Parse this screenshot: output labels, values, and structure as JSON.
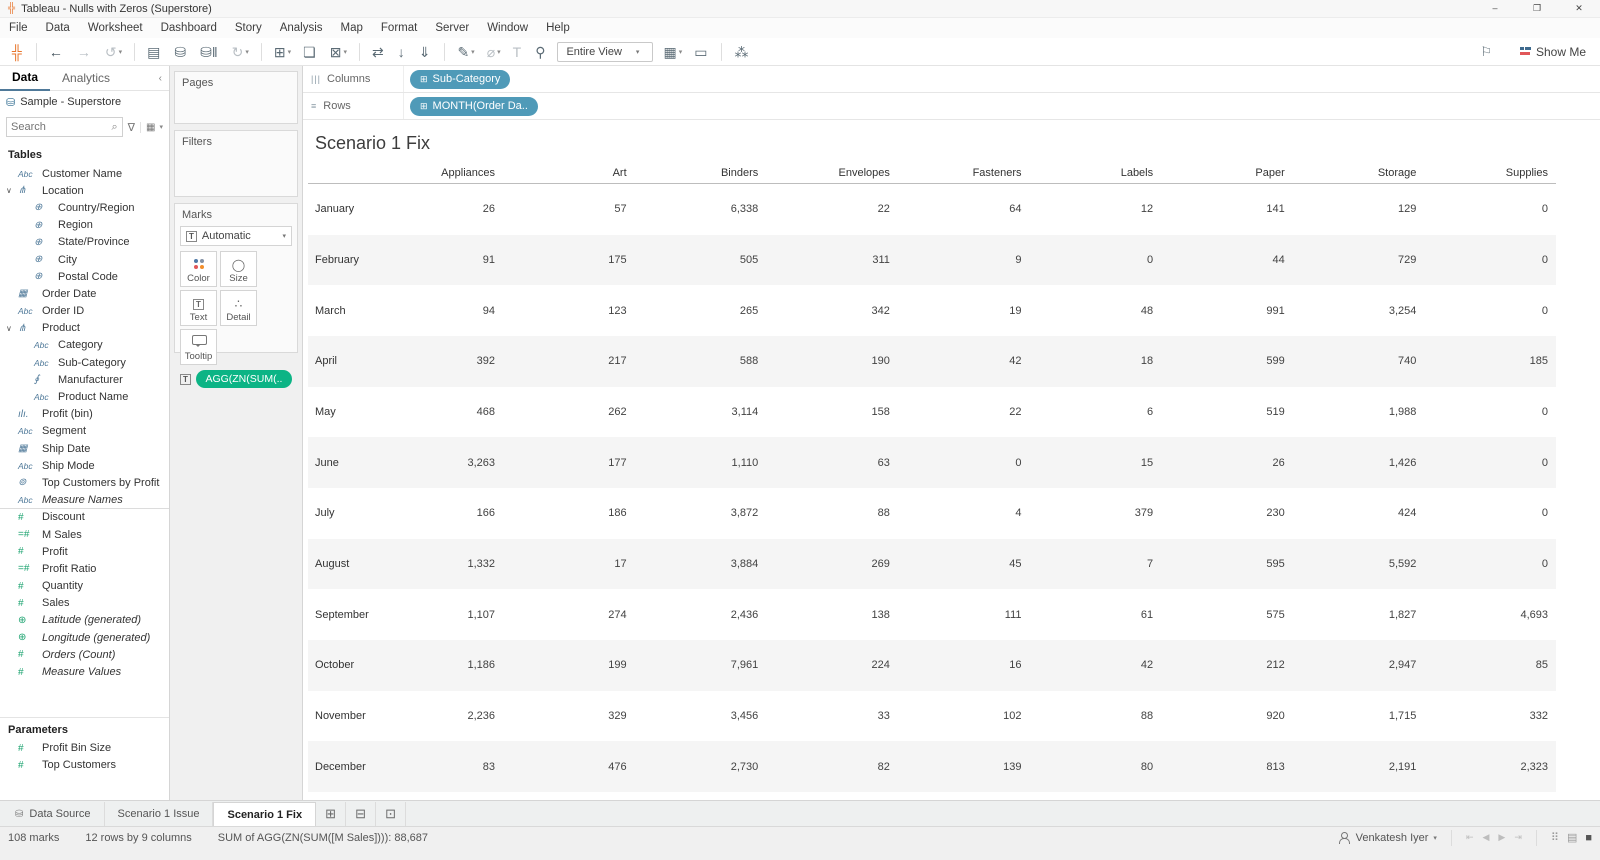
{
  "window": {
    "logo_glyph": "╬",
    "title": "Tableau - Nulls with Zeros (Superstore)",
    "controls": {
      "minimize": "–",
      "restore": "❐",
      "close": "✕"
    }
  },
  "menu": {
    "items": [
      "File",
      "Data",
      "Worksheet",
      "Dashboard",
      "Story",
      "Analysis",
      "Map",
      "Format",
      "Server",
      "Window",
      "Help"
    ]
  },
  "toolbar": {
    "buttons_left": [
      {
        "name": "tableau-logo-btn",
        "glyph": "╬",
        "inter": "true"
      },
      {
        "name": "toolbar-separator",
        "kind": "sep",
        "inter": "false"
      },
      {
        "name": "back-button",
        "glyph": "←",
        "inter": "true"
      },
      {
        "name": "forward-button",
        "glyph": "→",
        "disabled": "true",
        "inter": "true"
      },
      {
        "name": "replay-button",
        "glyph": "↺",
        "caret": "▾",
        "disabled": "true",
        "inter": "true"
      },
      {
        "name": "toolbar-separator",
        "kind": "sep",
        "inter": "false"
      },
      {
        "name": "save-button",
        "glyph": "▤",
        "inter": "true"
      },
      {
        "name": "new-datasource-button",
        "glyph": "⛁",
        "inter": "true"
      },
      {
        "name": "pause-updates-button",
        "glyph": "⛁‖",
        "inter": "true"
      },
      {
        "name": "auto-update-button",
        "glyph": "↻",
        "caret": "▾",
        "disabled": "true",
        "inter": "true"
      },
      {
        "name": "toolbar-separator",
        "kind": "sep",
        "inter": "false"
      },
      {
        "name": "new-worksheet-button",
        "glyph": "⊞",
        "caret": "▾",
        "inter": "true"
      },
      {
        "name": "duplicate-button",
        "glyph": "❏",
        "inter": "true"
      },
      {
        "name": "clear-sheet-button",
        "glyph": "⊠",
        "caret": "▾",
        "inter": "true"
      },
      {
        "name": "toolbar-separator",
        "kind": "sep",
        "inter": "false"
      },
      {
        "name": "swap-rows-columns-button",
        "glyph": "⇄",
        "inter": "true"
      },
      {
        "name": "sort-ascending-button",
        "glyph": "↓",
        "inter": "true"
      },
      {
        "name": "sort-descending-button",
        "glyph": "⇓",
        "inter": "true"
      },
      {
        "name": "toolbar-separator",
        "kind": "sep",
        "inter": "false"
      },
      {
        "name": "highlight-button",
        "glyph": "✎",
        "caret": "▾",
        "inter": "true"
      },
      {
        "name": "group-members-button",
        "glyph": "⌀",
        "caret": "▾",
        "disabled": "true",
        "inter": "true"
      },
      {
        "name": "show-mark-labels-button",
        "glyph": "T",
        "disabled": "true",
        "inter": "true"
      },
      {
        "name": "fix-axes-button",
        "glyph": "⚲",
        "inter": "true"
      }
    ],
    "fit_label": "Entire View",
    "fit_caret": "▾",
    "buttons_right": [
      {
        "name": "show-hide-cards-button",
        "glyph": "▦",
        "caret": "▾",
        "inter": "true"
      },
      {
        "name": "presentation-mode-button",
        "glyph": "▭",
        "inter": "true"
      },
      {
        "name": "toolbar-separator",
        "kind": "sep",
        "inter": "false"
      },
      {
        "name": "share-button",
        "glyph": "⁂",
        "inter": "true"
      }
    ],
    "flag_glyph": "⚐",
    "show_me_label": "Show Me"
  },
  "data_pane": {
    "tab_data": "Data",
    "tab_analytics": "Analytics",
    "collapse_glyph": "‹",
    "datasource": "Sample - Superstore",
    "datasource_icon_glyph": "⛁",
    "search_placeholder": "Search",
    "search_icon_glyph": "⌕",
    "filter_icon_glyph": "∇",
    "view_icon_glyph": "▦",
    "view_caret": "▾",
    "tables_label": "Tables",
    "fields": [
      {
        "icon": "abc-icon",
        "glyph": "Abc",
        "label": "Customer Name"
      },
      {
        "icon": "hierarchy-icon",
        "glyph": "⋔",
        "label": "Location",
        "caret": "∨"
      },
      {
        "icon": "globe-icon",
        "glyph": "⊕",
        "label": "Country/Region",
        "indent": "1"
      },
      {
        "icon": "globe-icon",
        "glyph": "⊕",
        "label": "Region",
        "indent": "1"
      },
      {
        "icon": "globe-icon",
        "glyph": "⊕",
        "label": "State/Province",
        "indent": "1"
      },
      {
        "icon": "globe-icon",
        "glyph": "⊕",
        "label": "City",
        "indent": "1"
      },
      {
        "icon": "globe-icon",
        "glyph": "⊕",
        "label": "Postal Code",
        "indent": "1"
      },
      {
        "icon": "calendar-icon",
        "glyph": "▦",
        "label": "Order Date"
      },
      {
        "icon": "abc-icon",
        "glyph": "Abc",
        "label": "Order ID"
      },
      {
        "icon": "hierarchy-icon",
        "glyph": "⋔",
        "label": "Product",
        "caret": "∨"
      },
      {
        "icon": "abc-icon",
        "glyph": "Abc",
        "label": "Category",
        "indent": "1"
      },
      {
        "icon": "abc-icon",
        "glyph": "Abc",
        "label": "Sub-Category",
        "indent": "1"
      },
      {
        "icon": "paperclip-icon",
        "glyph": "∮",
        "label": "Manufacturer",
        "indent": "1"
      },
      {
        "icon": "abc-icon",
        "glyph": "Abc",
        "label": "Product Name",
        "indent": "1"
      },
      {
        "icon": "bin-icon",
        "glyph": "ılı.",
        "label": "Profit (bin)"
      },
      {
        "icon": "abc-icon",
        "glyph": "Abc",
        "label": "Segment"
      },
      {
        "icon": "calendar-icon",
        "glyph": "▦",
        "label": "Ship Date"
      },
      {
        "icon": "abc-icon",
        "glyph": "Abc",
        "label": "Ship Mode"
      },
      {
        "icon": "set-icon",
        "glyph": "⊚",
        "label": "Top Customers by Profit"
      },
      {
        "icon": "abc-icon",
        "glyph": "Abc",
        "label": "Measure Names",
        "italic": "true",
        "sep": "true"
      },
      {
        "icon": "hash-icon",
        "glyph": "#",
        "label": "Discount",
        "color": "green"
      },
      {
        "icon": "calc-hash-icon",
        "glyph": "=#",
        "label": "M Sales",
        "color": "green"
      },
      {
        "icon": "hash-icon",
        "glyph": "#",
        "label": "Profit",
        "color": "green"
      },
      {
        "icon": "calc-hash-icon",
        "glyph": "=#",
        "label": "Profit Ratio",
        "color": "green"
      },
      {
        "icon": "hash-icon",
        "glyph": "#",
        "label": "Quantity",
        "color": "green"
      },
      {
        "icon": "hash-icon",
        "glyph": "#",
        "label": "Sales",
        "color": "green"
      },
      {
        "icon": "globe-icon",
        "glyph": "⊕",
        "label": "Latitude (generated)",
        "italic": "true",
        "color": "green"
      },
      {
        "icon": "globe-icon",
        "glyph": "⊕",
        "label": "Longitude (generated)",
        "italic": "true",
        "color": "green"
      },
      {
        "icon": "hash-icon",
        "glyph": "#",
        "label": "Orders (Count)",
        "italic": "true",
        "color": "green"
      },
      {
        "icon": "hash-icon",
        "glyph": "#",
        "label": "Measure Values",
        "italic": "true",
        "color": "green"
      }
    ],
    "parameters_label": "Parameters",
    "parameters": [
      {
        "icon": "hash-icon",
        "glyph": "#",
        "label": "Profit Bin Size",
        "color": "green"
      },
      {
        "icon": "hash-icon",
        "glyph": "#",
        "label": "Top Customers",
        "color": "green"
      }
    ]
  },
  "cards": {
    "pages_label": "Pages",
    "filters_label": "Filters",
    "marks": {
      "label": "Marks",
      "text_mark_glyph": "T",
      "mark_type": "Automatic",
      "dd_caret": "▾",
      "buttons": [
        {
          "btn": "color-button",
          "icon": "color-icon",
          "glyph": "",
          "label": "Color"
        },
        {
          "btn": "size-button",
          "icon": "size-icon",
          "glyph": "◯",
          "label": "Size"
        },
        {
          "btn": "text-button",
          "icon": "text-icon",
          "glyph": "T",
          "label": "Text"
        },
        {
          "btn": "detail-button",
          "icon": "detail-icon",
          "glyph": "∴",
          "label": "Detail"
        },
        {
          "btn": "tooltip-button",
          "icon": "tooltip-icon",
          "glyph": "",
          "label": "Tooltip"
        }
      ],
      "pill": "AGG(ZN(SUM(.."
    }
  },
  "shelves": {
    "columns_label": "Columns",
    "columns_icon_glyph": "|||",
    "rows_label": "Rows",
    "rows_icon_glyph": "≡",
    "columns_pills": [
      {
        "icon": "⊞",
        "label": "Sub-Category"
      }
    ],
    "rows_pills": [
      {
        "icon": "⊞",
        "label": "MONTH(Order Da.."
      }
    ]
  },
  "sheet": {
    "title": "Scenario 1 Fix",
    "columns": [
      "Appliances",
      "Art",
      "Binders",
      "Envelopes",
      "Fasteners",
      "Labels",
      "Paper",
      "Storage",
      "Supplies"
    ],
    "rows": [
      {
        "label": "January",
        "values": [
          "26",
          "57",
          "6,338",
          "22",
          "64",
          "12",
          "141",
          "129",
          "0"
        ]
      },
      {
        "label": "February",
        "values": [
          "91",
          "175",
          "505",
          "311",
          "9",
          "0",
          "44",
          "729",
          "0"
        ]
      },
      {
        "label": "March",
        "values": [
          "94",
          "123",
          "265",
          "342",
          "19",
          "48",
          "991",
          "3,254",
          "0"
        ]
      },
      {
        "label": "April",
        "values": [
          "392",
          "217",
          "588",
          "190",
          "42",
          "18",
          "599",
          "740",
          "185"
        ]
      },
      {
        "label": "May",
        "values": [
          "468",
          "262",
          "3,114",
          "158",
          "22",
          "6",
          "519",
          "1,988",
          "0"
        ]
      },
      {
        "label": "June",
        "values": [
          "3,263",
          "177",
          "1,110",
          "63",
          "0",
          "15",
          "26",
          "1,426",
          "0"
        ]
      },
      {
        "label": "July",
        "values": [
          "166",
          "186",
          "3,872",
          "88",
          "4",
          "379",
          "230",
          "424",
          "0"
        ]
      },
      {
        "label": "August",
        "values": [
          "1,332",
          "17",
          "3,884",
          "269",
          "45",
          "7",
          "595",
          "5,592",
          "0"
        ]
      },
      {
        "label": "September",
        "values": [
          "1,107",
          "274",
          "2,436",
          "138",
          "111",
          "61",
          "575",
          "1,827",
          "4,693"
        ]
      },
      {
        "label": "October",
        "values": [
          "1,186",
          "199",
          "7,961",
          "224",
          "16",
          "42",
          "212",
          "2,947",
          "85"
        ]
      },
      {
        "label": "November",
        "values": [
          "2,236",
          "329",
          "3,456",
          "33",
          "102",
          "88",
          "920",
          "1,715",
          "332"
        ]
      },
      {
        "label": "December",
        "values": [
          "83",
          "476",
          "2,730",
          "82",
          "139",
          "80",
          "813",
          "2,191",
          "2,323"
        ]
      }
    ]
  },
  "sheet_tabs": {
    "tabs": [
      {
        "label": "Data Source",
        "icon": "⛁"
      },
      {
        "label": "Scenario 1 Issue",
        "icon": ""
      },
      {
        "label": "Scenario 1 Fix",
        "icon": "",
        "active": "true"
      }
    ],
    "new_buttons": [
      {
        "name": "new-worksheet-tab-button",
        "glyph": "⊞"
      },
      {
        "name": "new-dashboard-tab-button",
        "glyph": "⊟"
      },
      {
        "name": "new-story-tab-button",
        "glyph": "⊡"
      }
    ]
  },
  "status_bar": {
    "marks": "108 marks",
    "dims": "12 rows by 9 columns",
    "agg": "SUM of AGG(ZN(SUM([M Sales]))): 88,687",
    "user": "Venkatesh Iyer",
    "user_caret": "▾",
    "nav": [
      {
        "name": "first-sheet-icon",
        "glyph": "⇤"
      },
      {
        "name": "prev-sheet-icon",
        "glyph": "◀"
      },
      {
        "name": "next-sheet-icon",
        "glyph": "▶"
      },
      {
        "name": "last-sheet-icon",
        "glyph": "⇥"
      }
    ],
    "views": [
      {
        "name": "tile-view-icon",
        "glyph": "⠿",
        "active": ""
      },
      {
        "name": "filmstrip-view-icon",
        "glyph": "▤",
        "active": ""
      },
      {
        "name": "sheet-sorter-view-icon",
        "glyph": "■",
        "active": "true"
      }
    ]
  }
}
